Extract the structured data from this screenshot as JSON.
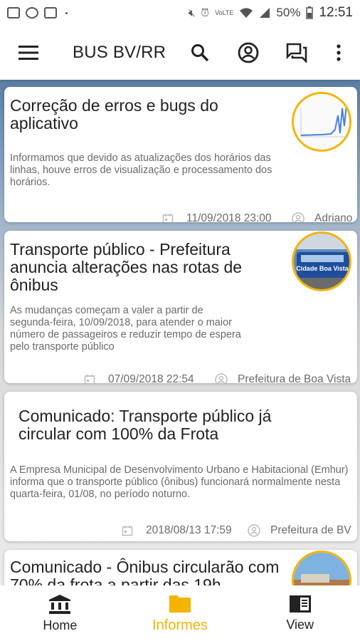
{
  "status_bar": {
    "battery": "50%",
    "time": "12:51",
    "network": "VoLTE"
  },
  "toolbar": {
    "title": "BUS BV/RR"
  },
  "cards": [
    {
      "title": "Correção de erros e bugs do aplicativo",
      "description": "Informamos que devido as atualizações dos horários das linhas, houve erros de visualização e processamento dos horários.",
      "date": "11/09/2018 23:00",
      "author": "Adriano"
    },
    {
      "title": "Transporte público - Prefeitura anuncia alterações nas rotas de ônibus",
      "description": "As mudanças começam a valer a partir de segunda-feira, 10/09/2018, para atender o maior número de passageiros e reduzir tempo de espera pelo transporte público",
      "date": "07/09/2018 22:54",
      "author": "Prefeitura de Boa Vista",
      "thumb_text": "Cidade Boa Vista"
    },
    {
      "title": "Comunicado: Transporte público já circular com 100% da Frota",
      "description": "A Empresa Municipal de Desenvolvimento Urbano e Habitacional (Emhur) informa que o transporte público (ônibus) funcionará normalmente nesta quarta-feira, 01/08, no período noturno.",
      "date": "2018/08/13 17:59",
      "author": "Prefeitura de BV"
    },
    {
      "title": "Comunicado - Ônibus circularão com 70% da frota a partir das 19h"
    }
  ],
  "bottom_nav": [
    {
      "label": "Home",
      "icon": "bank-icon"
    },
    {
      "label": "Informes",
      "icon": "folder-icon",
      "active": true
    },
    {
      "label": "View",
      "icon": "book-icon"
    }
  ],
  "colors": {
    "accent": "#f4b400",
    "text": "#222222",
    "muted": "#6a6a6a"
  }
}
